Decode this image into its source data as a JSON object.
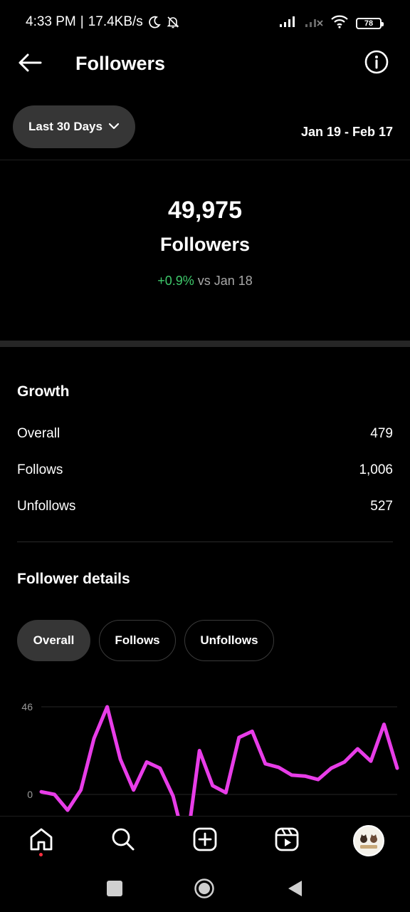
{
  "status_bar": {
    "time": "4:33 PM",
    "separator": "|",
    "network_speed": "17.4KB/s",
    "battery": "78",
    "icons": [
      "moon-icon",
      "bell-off-icon",
      "signal-icon",
      "signal-off-icon",
      "wifi-icon",
      "battery-icon"
    ]
  },
  "header": {
    "title": "Followers",
    "back_icon": "arrow-left-icon",
    "info_icon": "info-icon"
  },
  "filter": {
    "range_label": "Last 30 Days",
    "range_icon": "chevron-down-icon",
    "date_range": "Jan 19 - Feb 17"
  },
  "summary": {
    "count": "49,975",
    "label": "Followers",
    "change": "+0.9%",
    "change_suffix": " vs Jan 18",
    "change_color": "#3ec96b"
  },
  "growth": {
    "title": "Growth",
    "rows": [
      {
        "label": "Overall",
        "value": "479"
      },
      {
        "label": "Follows",
        "value": "1,006"
      },
      {
        "label": "Unfollows",
        "value": "527"
      }
    ]
  },
  "follower_details": {
    "title": "Follower details",
    "tabs": [
      {
        "label": "Overall",
        "active": true
      },
      {
        "label": "Follows",
        "active": false
      },
      {
        "label": "Unfollows",
        "active": false
      }
    ]
  },
  "chart_data": {
    "type": "line",
    "series": [
      {
        "values": [
          3,
          0,
          -18,
          5,
          64,
          100,
          40,
          5,
          37,
          30,
          -2,
          -62,
          50,
          10,
          2,
          65,
          72,
          35,
          31,
          22,
          21,
          17,
          30,
          37,
          52,
          38,
          80,
          30
        ]
      }
    ],
    "y_ticks": [
      "46",
      "0"
    ],
    "line_color": "#e83de8",
    "grid": true
  },
  "bottom_nav": {
    "items": [
      "home-icon",
      "search-icon",
      "create-icon",
      "reels-icon",
      "profile-avatar"
    ],
    "active": "home-icon"
  },
  "system_nav": {
    "items": [
      "recents-button",
      "home-button",
      "back-button"
    ]
  }
}
